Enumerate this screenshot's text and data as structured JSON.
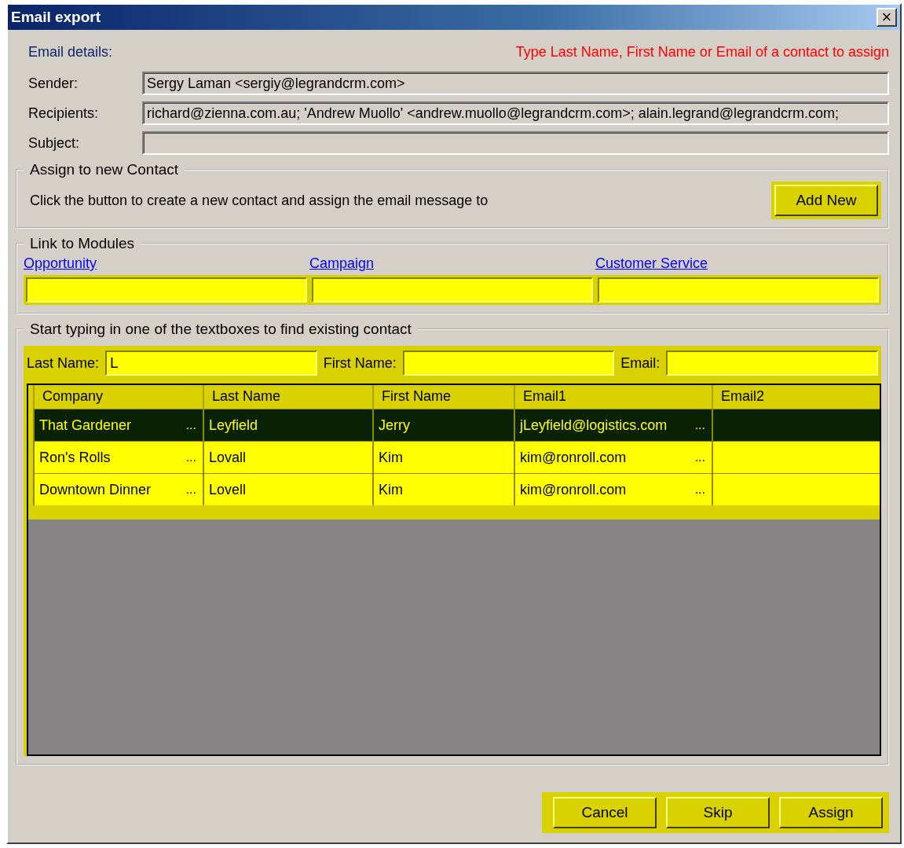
{
  "window": {
    "title": "Email export",
    "close": "×"
  },
  "email_details": {
    "heading": "Email details:",
    "hint": "Type Last Name, First Name or Email of a contact to assign",
    "fields": [
      {
        "label": "Sender:",
        "value": "Sergy Laman <sergiy@legrandcrm.com>"
      },
      {
        "label": "Recipients:",
        "value": "richard@zienna.com.au; 'Andrew Muollo' <andrew.muollo@legrandcrm.com>; alain.legrand@legrandcrm.com;"
      },
      {
        "label": "Subject:"
      }
    ]
  },
  "new_contact": {
    "legend": "Assign to new Contact",
    "text": "Click the button to create a new contact and assign the email message to",
    "button": {
      "label": "Add New"
    },
    "highlighted": true
  },
  "modules": {
    "legend": "Link to Modules",
    "highlighted": true,
    "links": [
      {
        "label": "Opportunity"
      },
      {
        "label": "Campaign"
      },
      {
        "label": "Customer Service"
      }
    ]
  },
  "search": {
    "legend": "Start typing in one of the textboxes to find existing contact",
    "highlighted": true,
    "fields": [
      {
        "label": "Last Name:",
        "value": "L"
      },
      {
        "label": "First Name:"
      },
      {
        "label": "Email:"
      }
    ]
  },
  "table": {
    "columns": [
      "Company",
      "Last Name",
      "First Name",
      "Email1",
      "Email2"
    ],
    "rows": [
      {
        "selected": true,
        "cells": [
          {
            "text": "That Gardener",
            "button": "..."
          },
          {
            "text": "Leyfield"
          },
          {
            "text": "Jerry"
          },
          {
            "text": "jLeyfield@logistics.com",
            "button": "..."
          },
          {}
        ]
      },
      {
        "selected": false,
        "cells": [
          {
            "text": "Ron's Rolls",
            "button": "..."
          },
          {
            "text": "Lovall"
          },
          {
            "text": "Kim"
          },
          {
            "text": "kim@ronroll.com",
            "button": "..."
          },
          {}
        ]
      },
      {
        "selected": false,
        "cells": [
          {
            "text": "Downtown Dinner",
            "button": "..."
          },
          {
            "text": "Lovell"
          },
          {
            "text": "Kim"
          },
          {
            "text": "kim@ronroll.com",
            "button": "..."
          },
          {}
        ]
      }
    ]
  },
  "buttons": {
    "highlighted": true,
    "items": [
      {
        "label": "Cancel"
      },
      {
        "label": "Skip"
      },
      {
        "label": "Assign"
      }
    ]
  }
}
